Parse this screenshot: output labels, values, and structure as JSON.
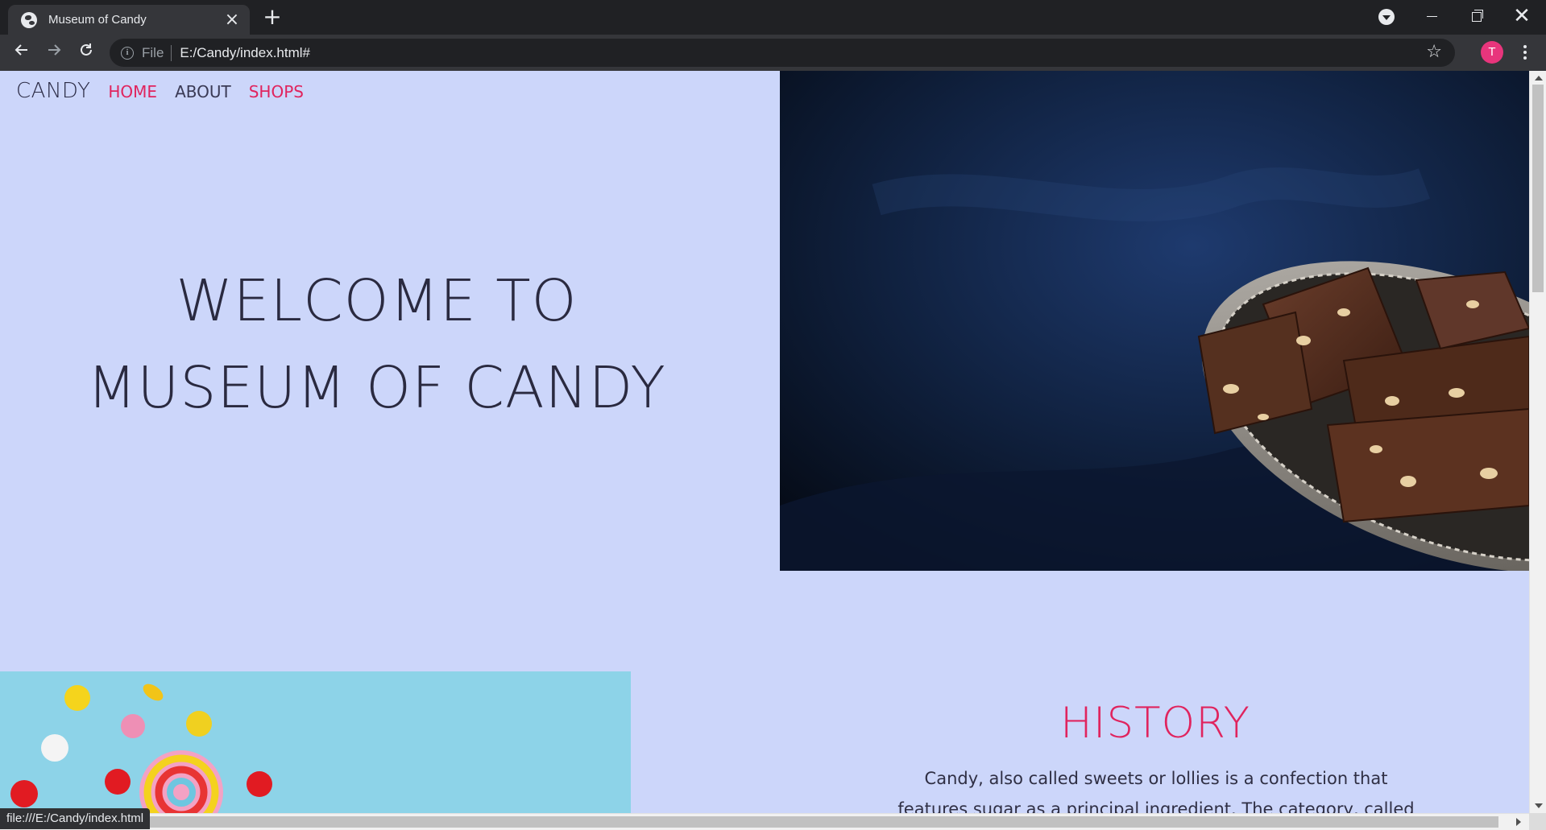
{
  "browser": {
    "tab_title": "Museum of Candy",
    "tab_close": "×",
    "new_tab": "+",
    "file_label": "File",
    "url": "E:/Candy/index.html#",
    "profile_initial": "T",
    "status_url": "file:///E:/Candy/index.html",
    "profile_color": "#e8357c"
  },
  "site": {
    "brand": "CANDY",
    "nav": [
      {
        "label": "HOME",
        "color": "#e0245e"
      },
      {
        "label": "ABOUT",
        "color": "#3a3a55"
      },
      {
        "label": "SHOPS",
        "color": "#e0245e"
      }
    ],
    "hero_line1": "WELCOME TO",
    "hero_line2": "MUSEUM OF CANDY",
    "history_title": "HISTORY",
    "history_text": "Candy, also called sweets or lollies is a confection that features sugar as a principal ingredient. The category, called"
  },
  "colors": {
    "page_bg": "#ccd6fa",
    "accent": "#e0245e",
    "text_dark": "#2a2a40"
  },
  "icons": {
    "favicon": "globe-icon",
    "back": "arrow-left-icon",
    "forward": "arrow-right-icon",
    "reload": "reload-icon",
    "info": "info-icon",
    "bookmark": "star-icon",
    "menu": "kebab-menu-icon",
    "tab_search": "tab-search-icon"
  }
}
